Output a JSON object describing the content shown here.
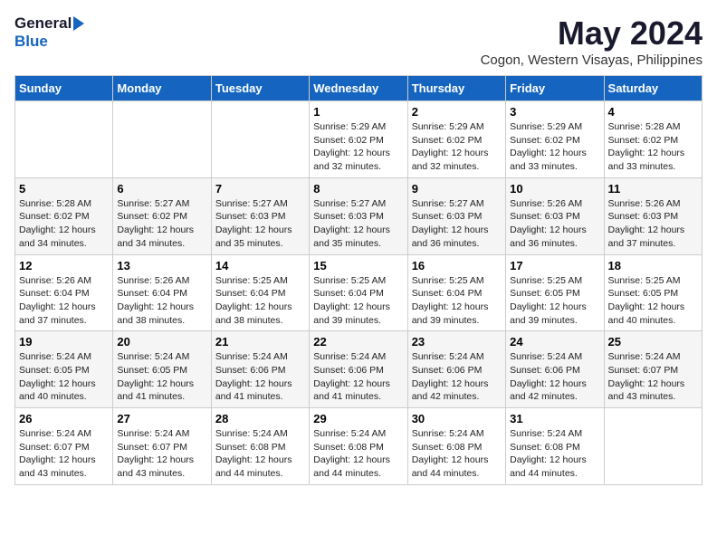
{
  "header": {
    "logo_general": "General",
    "logo_blue": "Blue",
    "month_title": "May 2024",
    "location": "Cogon, Western Visayas, Philippines"
  },
  "weekdays": [
    "Sunday",
    "Monday",
    "Tuesday",
    "Wednesday",
    "Thursday",
    "Friday",
    "Saturday"
  ],
  "weeks": [
    [
      {
        "day": "",
        "sunrise": "",
        "sunset": "",
        "daylight": ""
      },
      {
        "day": "",
        "sunrise": "",
        "sunset": "",
        "daylight": ""
      },
      {
        "day": "",
        "sunrise": "",
        "sunset": "",
        "daylight": ""
      },
      {
        "day": "1",
        "sunrise": "Sunrise: 5:29 AM",
        "sunset": "Sunset: 6:02 PM",
        "daylight": "Daylight: 12 hours and 32 minutes."
      },
      {
        "day": "2",
        "sunrise": "Sunrise: 5:29 AM",
        "sunset": "Sunset: 6:02 PM",
        "daylight": "Daylight: 12 hours and 32 minutes."
      },
      {
        "day": "3",
        "sunrise": "Sunrise: 5:29 AM",
        "sunset": "Sunset: 6:02 PM",
        "daylight": "Daylight: 12 hours and 33 minutes."
      },
      {
        "day": "4",
        "sunrise": "Sunrise: 5:28 AM",
        "sunset": "Sunset: 6:02 PM",
        "daylight": "Daylight: 12 hours and 33 minutes."
      }
    ],
    [
      {
        "day": "5",
        "sunrise": "Sunrise: 5:28 AM",
        "sunset": "Sunset: 6:02 PM",
        "daylight": "Daylight: 12 hours and 34 minutes."
      },
      {
        "day": "6",
        "sunrise": "Sunrise: 5:27 AM",
        "sunset": "Sunset: 6:02 PM",
        "daylight": "Daylight: 12 hours and 34 minutes."
      },
      {
        "day": "7",
        "sunrise": "Sunrise: 5:27 AM",
        "sunset": "Sunset: 6:03 PM",
        "daylight": "Daylight: 12 hours and 35 minutes."
      },
      {
        "day": "8",
        "sunrise": "Sunrise: 5:27 AM",
        "sunset": "Sunset: 6:03 PM",
        "daylight": "Daylight: 12 hours and 35 minutes."
      },
      {
        "day": "9",
        "sunrise": "Sunrise: 5:27 AM",
        "sunset": "Sunset: 6:03 PM",
        "daylight": "Daylight: 12 hours and 36 minutes."
      },
      {
        "day": "10",
        "sunrise": "Sunrise: 5:26 AM",
        "sunset": "Sunset: 6:03 PM",
        "daylight": "Daylight: 12 hours and 36 minutes."
      },
      {
        "day": "11",
        "sunrise": "Sunrise: 5:26 AM",
        "sunset": "Sunset: 6:03 PM",
        "daylight": "Daylight: 12 hours and 37 minutes."
      }
    ],
    [
      {
        "day": "12",
        "sunrise": "Sunrise: 5:26 AM",
        "sunset": "Sunset: 6:04 PM",
        "daylight": "Daylight: 12 hours and 37 minutes."
      },
      {
        "day": "13",
        "sunrise": "Sunrise: 5:26 AM",
        "sunset": "Sunset: 6:04 PM",
        "daylight": "Daylight: 12 hours and 38 minutes."
      },
      {
        "day": "14",
        "sunrise": "Sunrise: 5:25 AM",
        "sunset": "Sunset: 6:04 PM",
        "daylight": "Daylight: 12 hours and 38 minutes."
      },
      {
        "day": "15",
        "sunrise": "Sunrise: 5:25 AM",
        "sunset": "Sunset: 6:04 PM",
        "daylight": "Daylight: 12 hours and 39 minutes."
      },
      {
        "day": "16",
        "sunrise": "Sunrise: 5:25 AM",
        "sunset": "Sunset: 6:04 PM",
        "daylight": "Daylight: 12 hours and 39 minutes."
      },
      {
        "day": "17",
        "sunrise": "Sunrise: 5:25 AM",
        "sunset": "Sunset: 6:05 PM",
        "daylight": "Daylight: 12 hours and 39 minutes."
      },
      {
        "day": "18",
        "sunrise": "Sunrise: 5:25 AM",
        "sunset": "Sunset: 6:05 PM",
        "daylight": "Daylight: 12 hours and 40 minutes."
      }
    ],
    [
      {
        "day": "19",
        "sunrise": "Sunrise: 5:24 AM",
        "sunset": "Sunset: 6:05 PM",
        "daylight": "Daylight: 12 hours and 40 minutes."
      },
      {
        "day": "20",
        "sunrise": "Sunrise: 5:24 AM",
        "sunset": "Sunset: 6:05 PM",
        "daylight": "Daylight: 12 hours and 41 minutes."
      },
      {
        "day": "21",
        "sunrise": "Sunrise: 5:24 AM",
        "sunset": "Sunset: 6:06 PM",
        "daylight": "Daylight: 12 hours and 41 minutes."
      },
      {
        "day": "22",
        "sunrise": "Sunrise: 5:24 AM",
        "sunset": "Sunset: 6:06 PM",
        "daylight": "Daylight: 12 hours and 41 minutes."
      },
      {
        "day": "23",
        "sunrise": "Sunrise: 5:24 AM",
        "sunset": "Sunset: 6:06 PM",
        "daylight": "Daylight: 12 hours and 42 minutes."
      },
      {
        "day": "24",
        "sunrise": "Sunrise: 5:24 AM",
        "sunset": "Sunset: 6:06 PM",
        "daylight": "Daylight: 12 hours and 42 minutes."
      },
      {
        "day": "25",
        "sunrise": "Sunrise: 5:24 AM",
        "sunset": "Sunset: 6:07 PM",
        "daylight": "Daylight: 12 hours and 43 minutes."
      }
    ],
    [
      {
        "day": "26",
        "sunrise": "Sunrise: 5:24 AM",
        "sunset": "Sunset: 6:07 PM",
        "daylight": "Daylight: 12 hours and 43 minutes."
      },
      {
        "day": "27",
        "sunrise": "Sunrise: 5:24 AM",
        "sunset": "Sunset: 6:07 PM",
        "daylight": "Daylight: 12 hours and 43 minutes."
      },
      {
        "day": "28",
        "sunrise": "Sunrise: 5:24 AM",
        "sunset": "Sunset: 6:08 PM",
        "daylight": "Daylight: 12 hours and 44 minutes."
      },
      {
        "day": "29",
        "sunrise": "Sunrise: 5:24 AM",
        "sunset": "Sunset: 6:08 PM",
        "daylight": "Daylight: 12 hours and 44 minutes."
      },
      {
        "day": "30",
        "sunrise": "Sunrise: 5:24 AM",
        "sunset": "Sunset: 6:08 PM",
        "daylight": "Daylight: 12 hours and 44 minutes."
      },
      {
        "day": "31",
        "sunrise": "Sunrise: 5:24 AM",
        "sunset": "Sunset: 6:08 PM",
        "daylight": "Daylight: 12 hours and 44 minutes."
      },
      {
        "day": "",
        "sunrise": "",
        "sunset": "",
        "daylight": ""
      }
    ]
  ]
}
